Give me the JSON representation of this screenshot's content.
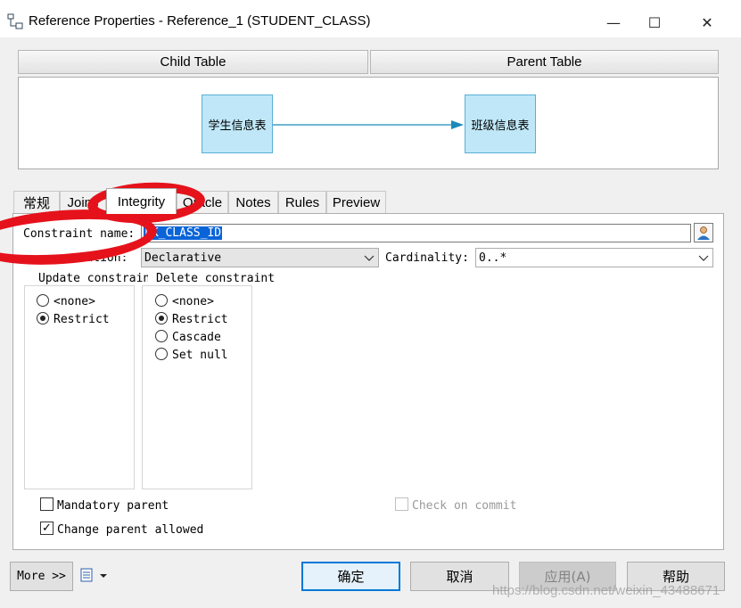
{
  "window": {
    "title": "Reference Properties - Reference_1 (STUDENT_CLASS)",
    "minimize_glyph": "—",
    "maximize_glyph": "☐",
    "close_glyph": "✕"
  },
  "headers": {
    "child": "Child Table",
    "parent": "Parent Table"
  },
  "diagram": {
    "child_table": "学生信息表",
    "parent_table": "班级信息表"
  },
  "tabs": [
    {
      "label": "常规"
    },
    {
      "label": "Joins"
    },
    {
      "label": "Integrity"
    },
    {
      "label": "Oracle"
    },
    {
      "label": "Notes"
    },
    {
      "label": "Rules"
    },
    {
      "label": "Preview"
    }
  ],
  "form": {
    "constraint_name_label": "Constraint name:",
    "constraint_name_value": "FK_CLASS_ID",
    "implementation_label": "Implementation:",
    "implementation_value": "Declarative",
    "cardinality_label": "Cardinality:",
    "cardinality_value": "0..*"
  },
  "update_constraint": {
    "label": "Update constraint",
    "options": [
      {
        "label": "<none>",
        "selected": false
      },
      {
        "label": "Restrict",
        "selected": true
      }
    ]
  },
  "delete_constraint": {
    "label": "Delete constraint",
    "options": [
      {
        "label": "<none>",
        "selected": false
      },
      {
        "label": "Restrict",
        "selected": true
      },
      {
        "label": "Cascade",
        "selected": false
      },
      {
        "label": "Set null",
        "selected": false
      }
    ]
  },
  "checkboxes": {
    "mandatory_parent": {
      "label": "Mandatory parent",
      "checked": false
    },
    "change_parent_allowed": {
      "label": "Change parent allowed",
      "checked": true
    },
    "check_on_commit": {
      "label": "Check on commit",
      "checked": false,
      "enabled": false
    }
  },
  "footer": {
    "more": "More >>",
    "ok": "确定",
    "cancel": "取消",
    "apply": "应用(A)",
    "help": "帮助"
  },
  "watermark": "https://blog.csdn.net/weixin_43488671",
  "colors": {
    "annotation": "#e5121c",
    "selection": "#0a64d8",
    "table_fill": "#bfe7f7",
    "table_border": "#5aaed6"
  }
}
